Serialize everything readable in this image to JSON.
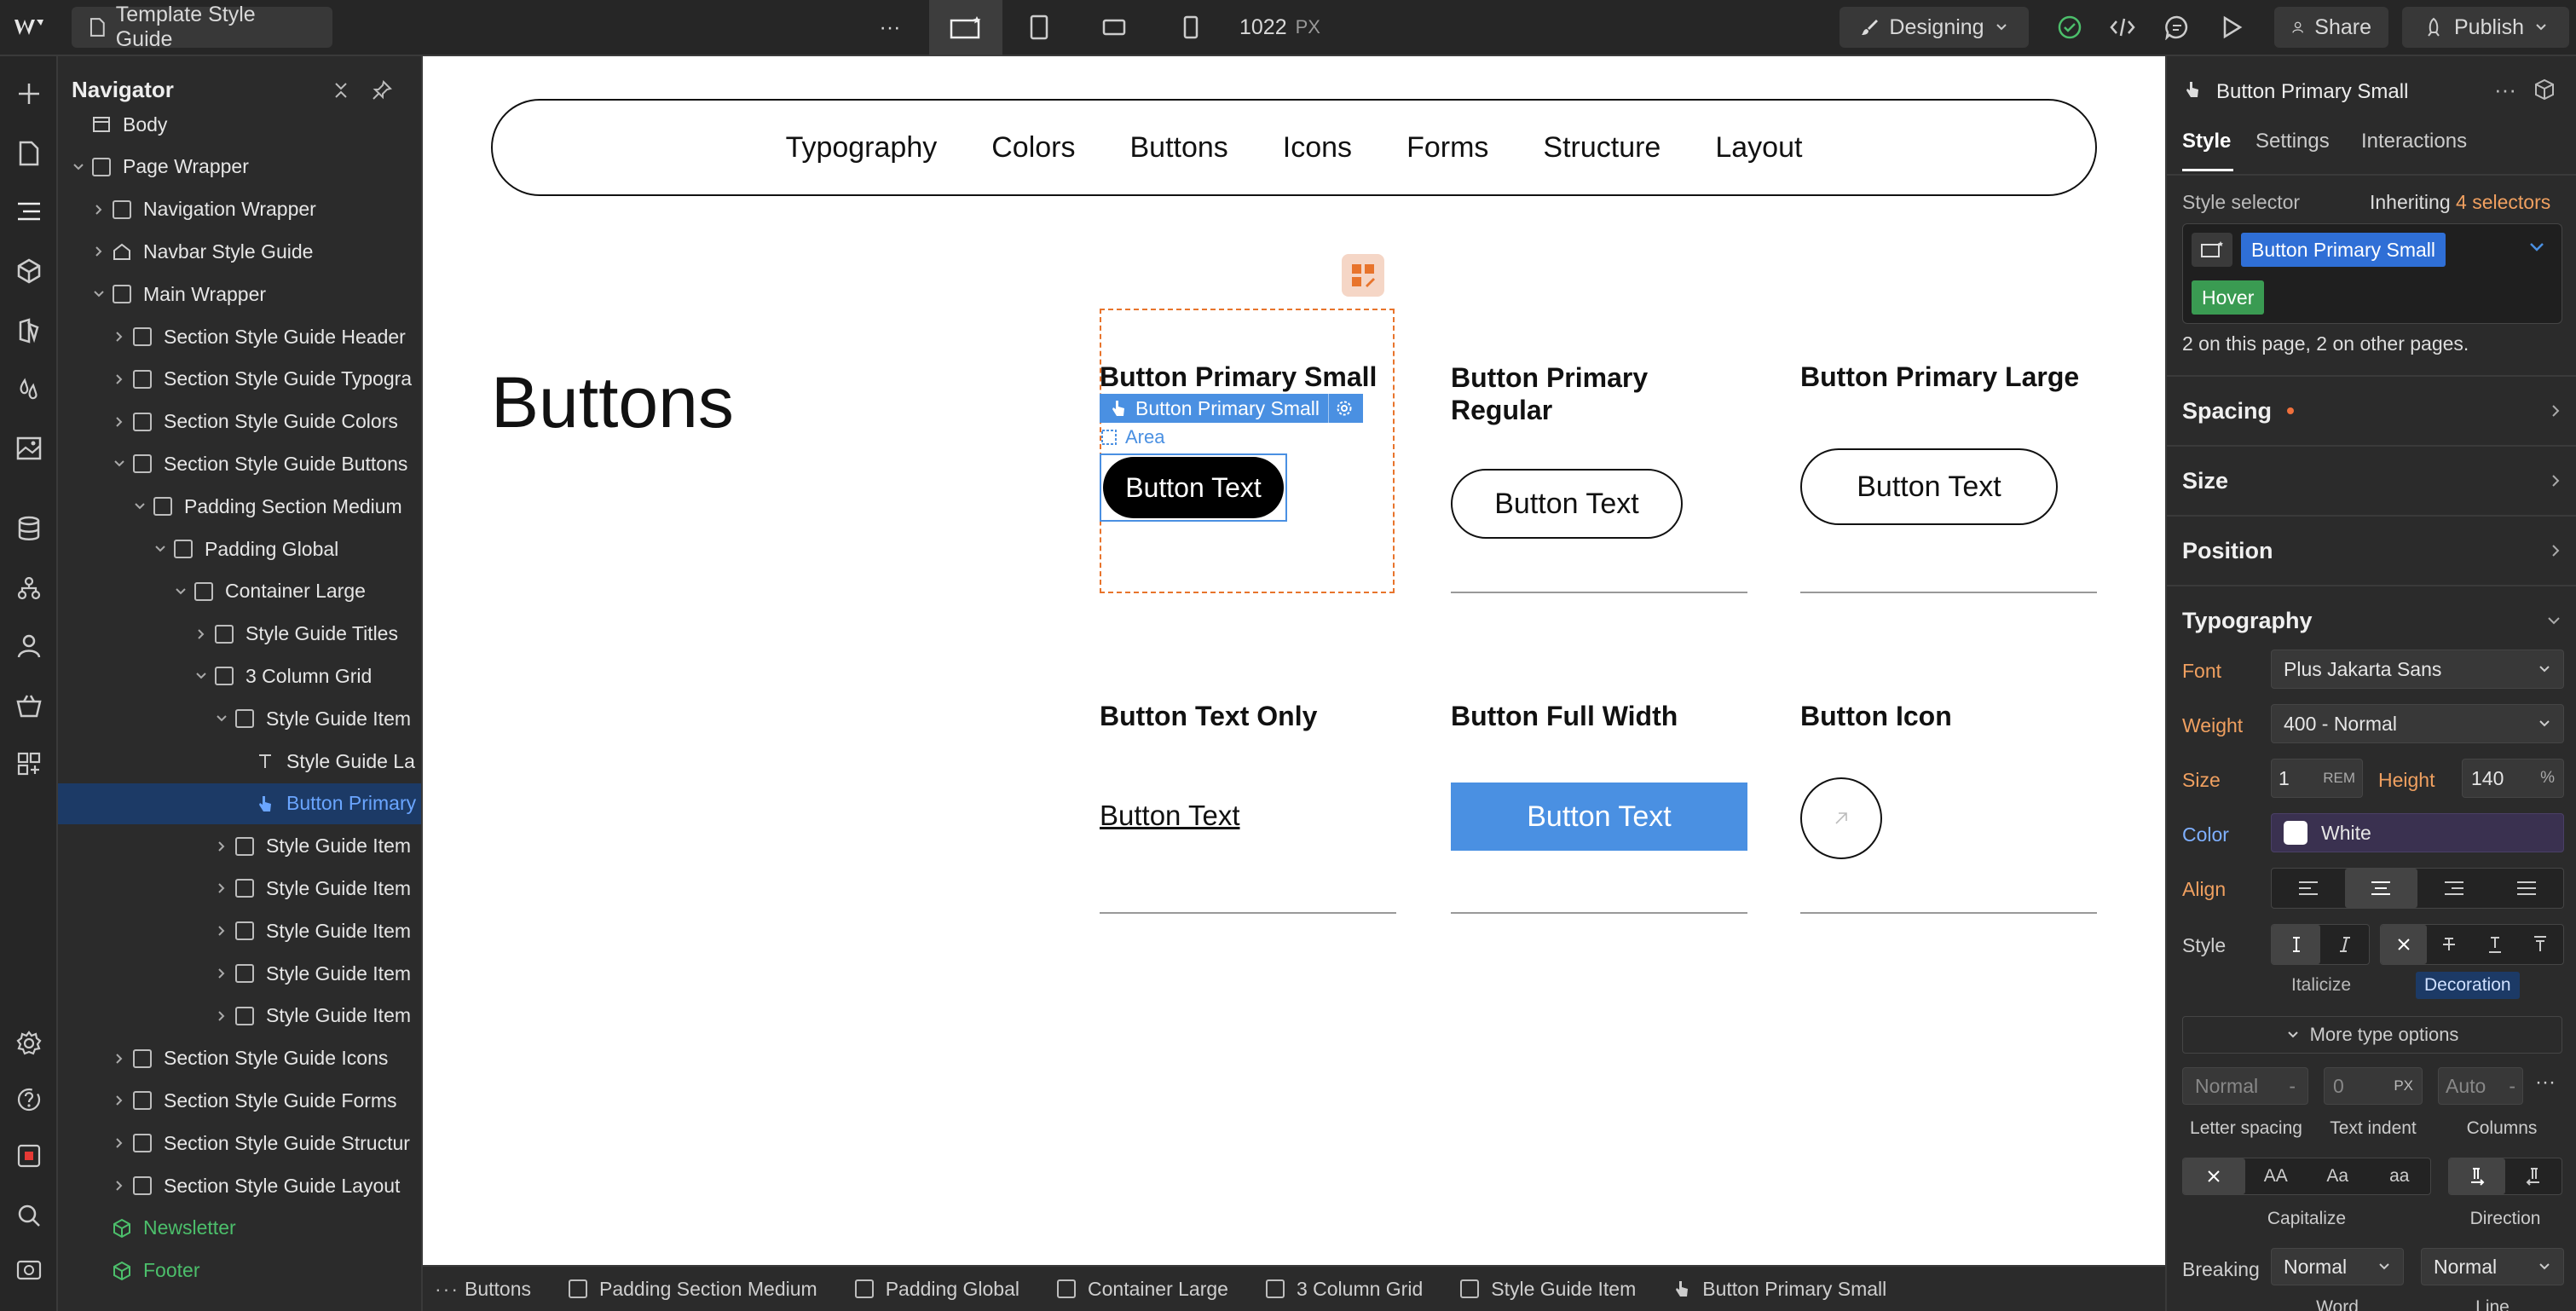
{
  "topbar": {
    "page_name": "Template Style Guide",
    "more": "···",
    "width_value": "1022",
    "width_unit": "PX",
    "mode": "Designing",
    "share": "Share",
    "publish": "Publish"
  },
  "navigator": {
    "title": "Navigator",
    "items": [
      {
        "label": "Body",
        "depth": 0,
        "caret": "",
        "kind": "body"
      },
      {
        "label": "Page Wrapper",
        "depth": 0,
        "caret": "v",
        "kind": "box"
      },
      {
        "label": "Navigation Wrapper",
        "depth": 1,
        "caret": ">",
        "kind": "box"
      },
      {
        "label": "Navbar Style Guide",
        "depth": 1,
        "caret": ">",
        "kind": "home"
      },
      {
        "label": "Main Wrapper",
        "depth": 1,
        "caret": "v",
        "kind": "box"
      },
      {
        "label": "Section Style Guide Header",
        "depth": 2,
        "caret": ">",
        "kind": "box"
      },
      {
        "label": "Section Style Guide Typogra",
        "depth": 2,
        "caret": ">",
        "kind": "box"
      },
      {
        "label": "Section Style Guide Colors",
        "depth": 2,
        "caret": ">",
        "kind": "box"
      },
      {
        "label": "Section Style Guide Buttons",
        "depth": 2,
        "caret": "v",
        "kind": "box"
      },
      {
        "label": "Padding Section Medium",
        "depth": 3,
        "caret": "v",
        "kind": "box"
      },
      {
        "label": "Padding Global",
        "depth": 4,
        "caret": "v",
        "kind": "box"
      },
      {
        "label": "Container Large",
        "depth": 5,
        "caret": "v",
        "kind": "box"
      },
      {
        "label": "Style Guide Titles",
        "depth": 6,
        "caret": ">",
        "kind": "box"
      },
      {
        "label": "3 Column Grid",
        "depth": 6,
        "caret": "v",
        "kind": "box"
      },
      {
        "label": "Style Guide Item",
        "depth": 7,
        "caret": "v",
        "kind": "box"
      },
      {
        "label": "Style Guide La",
        "depth": 8,
        "caret": "",
        "kind": "text"
      },
      {
        "label": "Button Primary",
        "depth": 8,
        "caret": "",
        "kind": "hand",
        "selected": true
      },
      {
        "label": "Style Guide Item",
        "depth": 7,
        "caret": ">",
        "kind": "box"
      },
      {
        "label": "Style Guide Item",
        "depth": 7,
        "caret": ">",
        "kind": "box"
      },
      {
        "label": "Style Guide Item",
        "depth": 7,
        "caret": ">",
        "kind": "box"
      },
      {
        "label": "Style Guide Item",
        "depth": 7,
        "caret": ">",
        "kind": "box"
      },
      {
        "label": "Style Guide Item",
        "depth": 7,
        "caret": ">",
        "kind": "box"
      },
      {
        "label": "Section Style Guide Icons",
        "depth": 2,
        "caret": ">",
        "kind": "box"
      },
      {
        "label": "Section Style Guide Forms",
        "depth": 2,
        "caret": ">",
        "kind": "box"
      },
      {
        "label": "Section Style Guide Structur",
        "depth": 2,
        "caret": ">",
        "kind": "box"
      },
      {
        "label": "Section Style Guide Layout",
        "depth": 2,
        "caret": ">",
        "kind": "box"
      },
      {
        "label": "Newsletter",
        "depth": 1,
        "caret": "",
        "kind": "comp"
      },
      {
        "label": "Footer",
        "depth": 1,
        "caret": "",
        "kind": "comp"
      }
    ]
  },
  "canvas": {
    "nav_links": [
      "Typography",
      "Colors",
      "Buttons",
      "Icons",
      "Forms",
      "Structure",
      "Layout"
    ],
    "section_title": "Buttons",
    "selected_tag": "Button Primary Small",
    "area_label": "Area",
    "items": [
      {
        "title": "Button Primary Small",
        "button": "Button Text"
      },
      {
        "title": "Button Primary Regular",
        "button": "Button Text"
      },
      {
        "title": "Button Primary Large",
        "button": "Button Text"
      },
      {
        "title": "Button Text Only",
        "button": "Button Text"
      },
      {
        "title": "Button Full Width",
        "button": "Button Text"
      },
      {
        "title": "Button Icon",
        "button": ""
      }
    ],
    "accent": "#4a90e2"
  },
  "breadcrumbs": [
    "Buttons",
    "Padding Section Medium",
    "Padding Global",
    "Container Large",
    "3 Column Grid",
    "Style Guide Item",
    "Button Primary Small"
  ],
  "panel": {
    "element_name": "Button Primary Small",
    "tabs": [
      "Style",
      "Settings",
      "Interactions"
    ],
    "style_selector_label": "Style selector",
    "inheriting_prefix": "Inheriting",
    "inheriting_count": "4 selectors",
    "selector_class": "Button Primary Small",
    "state": "Hover",
    "usage": "2 on this page, 2 on other pages.",
    "sections": [
      "Spacing",
      "Size",
      "Position",
      "Typography"
    ],
    "typography": {
      "font_label": "Font",
      "font": "Plus Jakarta Sans",
      "weight_label": "Weight",
      "weight": "400 - Normal",
      "size_label": "Size",
      "size": "1",
      "size_unit": "REM",
      "height_label": "Height",
      "height": "140",
      "height_unit": "%",
      "color_label": "Color",
      "color": "White",
      "align_label": "Align",
      "style_label": "Style",
      "italicize": "Italicize",
      "decoration": "Decoration",
      "more": "More type options",
      "letter_spacing": "Normal",
      "letter_spacing_unit": "-",
      "text_indent": "0",
      "text_indent_unit": "PX",
      "columns": "Auto",
      "columns_unit": "-",
      "letter_spacing_label": "Letter spacing",
      "text_indent_label": "Text indent",
      "columns_label": "Columns",
      "cap_opts": [
        "AA",
        "Aa",
        "aa"
      ],
      "capitalize_label": "Capitalize",
      "direction_label": "Direction",
      "breaking_label": "Breaking",
      "breaking_1": "Normal",
      "breaking_2": "Normal",
      "word_label": "Word",
      "line_label": "Line"
    }
  }
}
